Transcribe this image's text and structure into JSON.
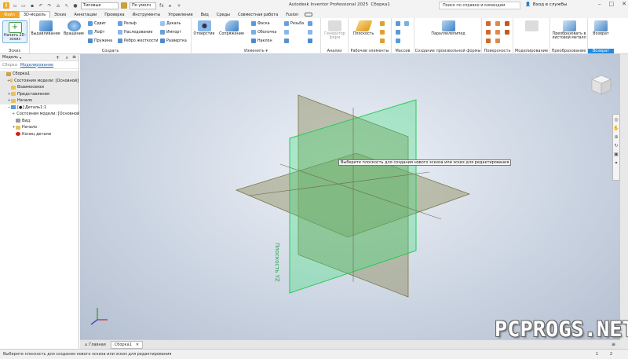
{
  "titlebar": {
    "file_label": "Файл",
    "appearance_select": "Типовые",
    "material_select": "По умолч",
    "fx": "fx",
    "title": "Autodesk Inventor Professional 2025",
    "document": "Сборка1",
    "search_placeholder": "Поиск по справке и командам",
    "signin": "Вход в службы"
  },
  "tabs": [
    "3D-модель",
    "Эскиз",
    "Аннотации",
    "Проверка",
    "Инструменты",
    "Управление",
    "Вид",
    "Среды",
    "Совместная работа",
    "Fusion"
  ],
  "ribbon": {
    "sketch": {
      "start": "Начать 2D-эскиз",
      "label": "Эскиз"
    },
    "create": {
      "extrude": "Выдавливание",
      "revolve": "Вращение",
      "sweep": "Сдвиг",
      "loft": "Лофт",
      "coil": "Пружина",
      "emboss": "Рельф",
      "derive": "Наследование",
      "rib": "Ребро жесткости",
      "decal": "Декаль",
      "import": "Импорт",
      "unwrap": "Развертка",
      "label": "Создать"
    },
    "modify": {
      "hole": "Отверстие",
      "fillet": "Сопряжение",
      "chamfer": "Фаска",
      "shell": "Оболочка",
      "draft": "Наклон",
      "thread": "Резьба",
      "label": "Изменить"
    },
    "explore": {
      "generate": "Генератор форм",
      "label": "Анализ"
    },
    "workfeatures": {
      "plane": "Плоскость",
      "label": "Рабочие элементы"
    },
    "pattern": {
      "label": "Массив"
    },
    "freeform": {
      "box": "Параллелепипед",
      "label": "Создание произвольной формы"
    },
    "surface": {
      "label": "Поверхность"
    },
    "simplify": {
      "label": "Моделирование"
    },
    "convert": {
      "btn": "Преобразовать в листовой металл",
      "label": "Преобразование"
    },
    "return": {
      "btn": "Возврат",
      "label": "Возврат"
    }
  },
  "browser": {
    "title": "Модель",
    "tab_view": "Сборка",
    "tab_model": "Моделирование",
    "rows": [
      {
        "text": "Сборка1",
        "indent": 0,
        "shaded": true,
        "expand": "",
        "icon": "assembly"
      },
      {
        "text": "Состояния модели: [Основной]",
        "indent": 1,
        "shaded": true,
        "expand": "+",
        "icon": "folder"
      },
      {
        "text": "Взаимосвязи",
        "indent": 1,
        "shaded": true,
        "expand": "",
        "icon": "folder"
      },
      {
        "text": "Представления",
        "indent": 1,
        "shaded": true,
        "expand": "+",
        "icon": "folder"
      },
      {
        "text": "Начало",
        "indent": 1,
        "shaded": true,
        "expand": "+",
        "icon": "folder"
      },
      {
        "text": "[●]:Деталь1:1",
        "indent": 1,
        "shaded": false,
        "expand": "−",
        "icon": "part"
      },
      {
        "text": "Состояния модели: [Основной]",
        "indent": 2,
        "shaded": false,
        "expand": "+",
        "icon": "folder"
      },
      {
        "text": "Вид:",
        "indent": 2,
        "shaded": false,
        "expand": "",
        "icon": "view"
      },
      {
        "text": "Начало",
        "indent": 2,
        "shaded": false,
        "expand": "+",
        "icon": "folder"
      },
      {
        "text": "Конец детали",
        "indent": 2,
        "shaded": false,
        "expand": "",
        "icon": "end"
      }
    ]
  },
  "viewport": {
    "tooltip": "Выберите плоскость для создания нового эскиза или эскиз для редактирования",
    "plane_label": "Плоскость YZ"
  },
  "doctabs": {
    "home": "Главная",
    "doc": "Сборка1"
  },
  "status": {
    "text": "Выберите плоскость для создания нового эскиза или эскиз для редактирования",
    "n1": "1",
    "n2": "2"
  },
  "watermark": "PCPROGS.NET",
  "colors": {
    "accent": "#f5a623",
    "plane_green": "#3fe07a",
    "plane_olive": "#8c8a58",
    "return_blue": "#1f8be0"
  }
}
